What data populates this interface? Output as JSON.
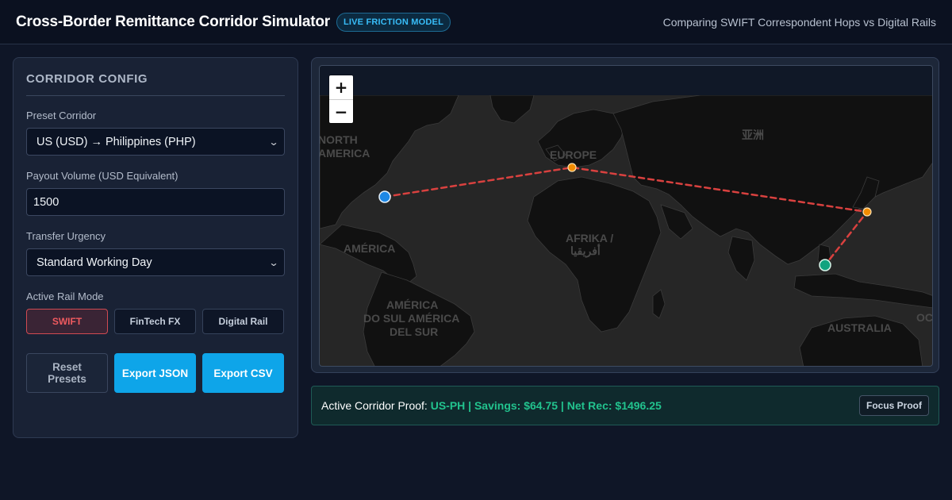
{
  "header": {
    "title": "Cross-Border Remittance Corridor Simulator",
    "badge": "LIVE FRICTION MODEL",
    "subtitle": "Comparing SWIFT Correspondent Hops vs Digital Rails"
  },
  "sidebar": {
    "title": "CORRIDOR CONFIG",
    "preset_label": "Preset Corridor",
    "preset_value": "US (USD) → Philippines (PHP)",
    "volume_label": "Payout Volume (USD Equivalent)",
    "volume_value": "1500",
    "urgency_label": "Transfer Urgency",
    "urgency_value": "Standard Working Day",
    "rail_label": "Active Rail Mode",
    "rail_modes": [
      "SWIFT",
      "FinTech FX",
      "Digital Rail"
    ],
    "active_mode": "SWIFT",
    "actions": {
      "reset": "Reset Presets",
      "export_json": "Export JSON",
      "export_csv": "Export CSV"
    }
  },
  "map": {
    "zoom_in": "+",
    "zoom_out": "−",
    "labels": {
      "north_america": [
        "NORTH",
        "AMERICA"
      ],
      "europe": "EUROPE",
      "asia": "亚洲",
      "africa": [
        "AFRIKA /",
        "أفريقيا"
      ],
      "america": "AMÉRICA",
      "south_america": [
        "AMÉRICA",
        "DO SUL AMÉRICA",
        "DEL SUR"
      ],
      "australia": "AUSTRALIA",
      "ocean": "OC"
    },
    "route_color": "#d9413f",
    "origin_color": "#1e88e5",
    "hop_color": "#f28c00",
    "destination_color": "#10a37f"
  },
  "proof": {
    "label": "Active Corridor Proof:",
    "value": "US-PH | Savings: $64.75 | Net Rec: $1496.25",
    "button": "Focus Proof"
  },
  "colors": {
    "accent": "#0ea5e9",
    "danger": "#ef5a5f",
    "success": "#22c38e"
  }
}
